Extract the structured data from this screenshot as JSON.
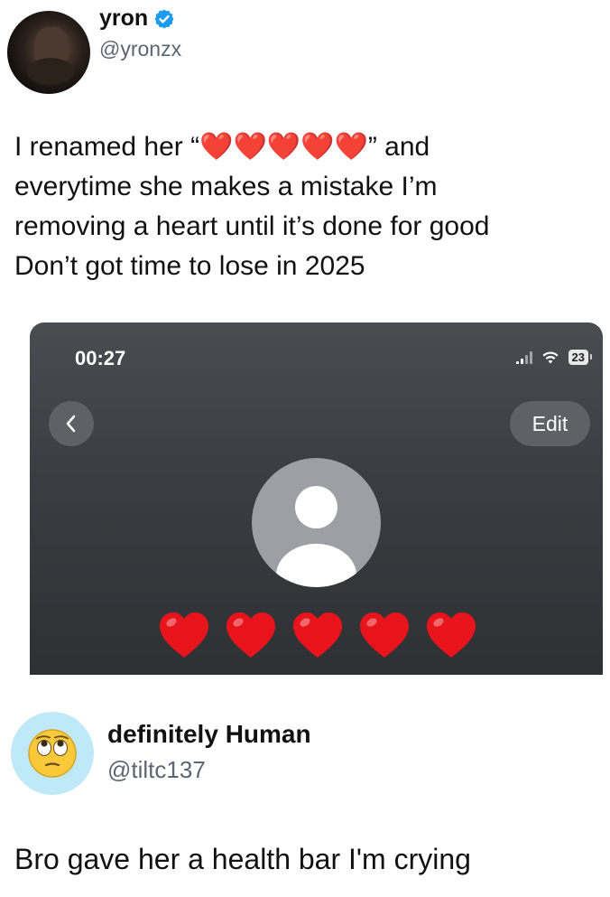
{
  "tweet": {
    "display_name": "yron",
    "handle": "@yronzx",
    "lines": [
      "I renamed her “❤️❤️❤️❤️❤️” and",
      "everytime she makes a mistake I’m",
      "removing a heart until it’s done for good",
      "Don’t got time to lose in 2025"
    ]
  },
  "phone": {
    "time": "00:27",
    "battery": "23",
    "back_icon": "chevron-left-icon",
    "edit_label": "Edit",
    "heart_count": 5,
    "heart_color": "#e8141c"
  },
  "reply": {
    "display_name": "definitely Human",
    "handle": "@tiltc137",
    "text": "Bro gave her a health bar I'm crying"
  },
  "colors": {
    "verified": "#1d9bf0",
    "handle": "#5b6670",
    "phone_bg": "#3c3e43"
  }
}
